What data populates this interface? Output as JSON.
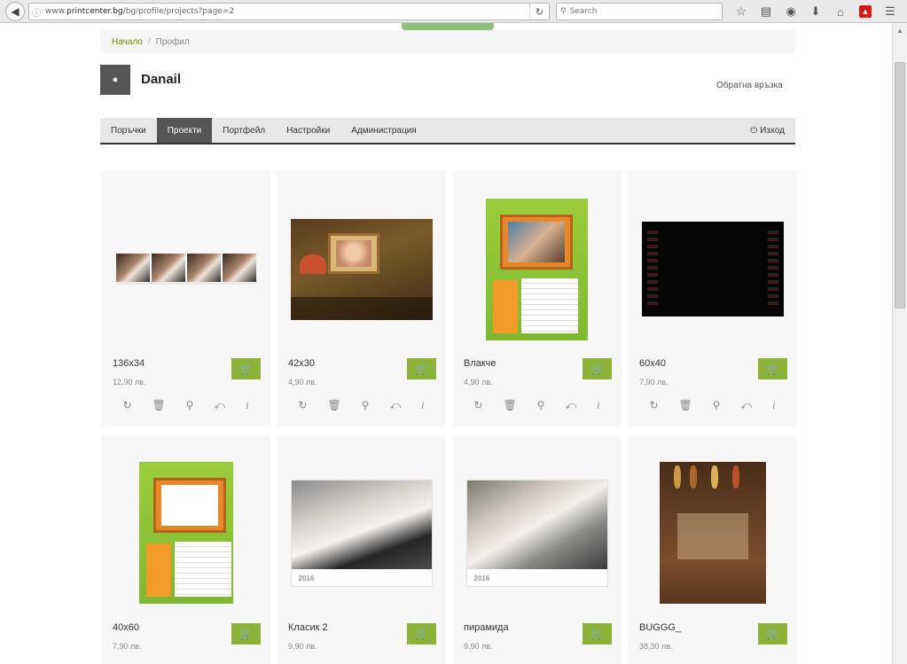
{
  "browser": {
    "url_prefix": "www.",
    "url_domain": "printcenter.bg",
    "url_path": "/bg/profile/projects?page=2",
    "search_placeholder": "Search"
  },
  "breadcrumb": {
    "home": "Начало",
    "separator": "/",
    "current": "Профил"
  },
  "profile": {
    "username": "Danail",
    "feedback_link": "Обратна връзка"
  },
  "nav": {
    "items": [
      {
        "label": "Поръчки"
      },
      {
        "label": "Проекти",
        "active": true
      },
      {
        "label": "Портфейл"
      },
      {
        "label": "Настройки"
      },
      {
        "label": "Администрация"
      }
    ],
    "logout": "Изход"
  },
  "colors": {
    "accent_green": "#8db33a",
    "nav_active": "#555555",
    "breadcrumb_home": "#7a8a00"
  },
  "projects": [
    {
      "name": "136x34",
      "price": "12,90 лв.",
      "thumb": "photo-strip"
    },
    {
      "name": "42x30",
      "price": "4,90 лв.",
      "thumb": "autumn-calendar"
    },
    {
      "name": "Влакче",
      "price": "4,90 лв.",
      "thumb": "green-calendar-family"
    },
    {
      "name": "60x40",
      "price": "7,90 лв.",
      "thumb": "black-calendar"
    },
    {
      "name": "40x60",
      "price": "7,90 лв.",
      "thumb": "green-calendar-empty"
    },
    {
      "name": "Класик 2",
      "price": "9,90 лв.",
      "thumb": "wedding-calendar",
      "year": "2016"
    },
    {
      "name": "пирамида",
      "price": "9,90 лв.",
      "thumb": "wedding-calendar",
      "year": "2016"
    },
    {
      "name": "BUGGG_",
      "price": "38,30 лв.",
      "thumb": "wood-spices"
    }
  ],
  "card_actions": [
    "refresh-icon",
    "trash-icon",
    "zoom-icon",
    "share-icon",
    "info-icon"
  ],
  "cart_icon": "basket-icon"
}
